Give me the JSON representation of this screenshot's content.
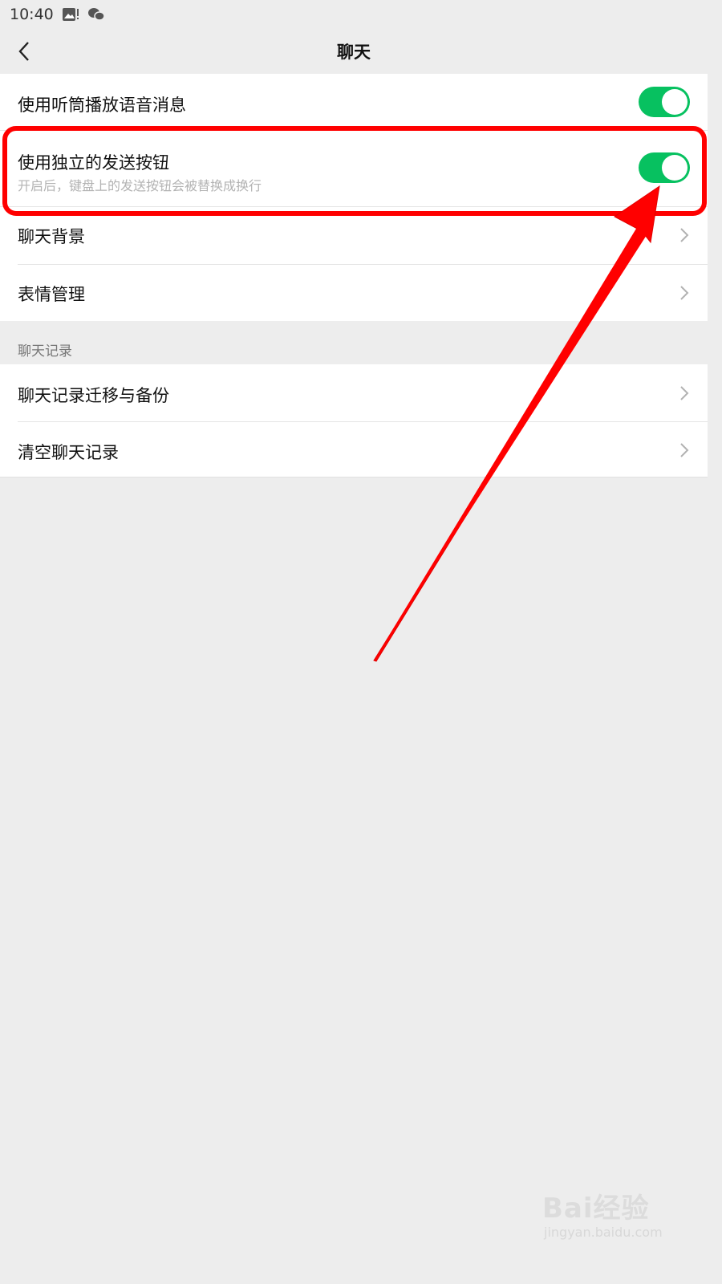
{
  "status_bar": {
    "time": "10:40"
  },
  "nav": {
    "title": "聊天"
  },
  "group1": [
    {
      "label": "使用听筒播放语音消息",
      "toggle_on": true
    },
    {
      "label": "使用独立的发送按钮",
      "sub": "开启后，键盘上的发送按钮会被替换成换行",
      "toggle_on": true
    },
    {
      "label": "聊天背景"
    },
    {
      "label": "表情管理"
    }
  ],
  "section_title": "聊天记录",
  "group2": [
    {
      "label": "聊天记录迁移与备份"
    },
    {
      "label": "清空聊天记录"
    }
  ],
  "colors": {
    "accent_green": "#07c160",
    "annotation_red": "#ff0000"
  },
  "watermark": {
    "main": "Bai经验",
    "sub": "jingyan.baidu.com"
  }
}
